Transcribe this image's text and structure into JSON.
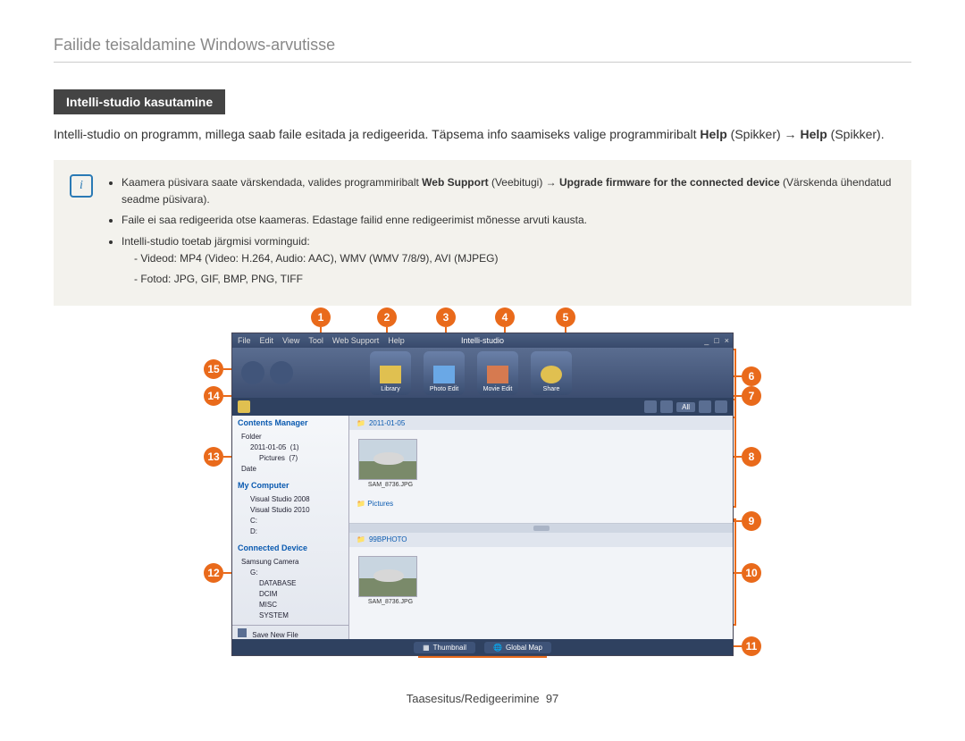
{
  "page": {
    "header": "Failide teisaldamine Windows-arvutisse",
    "section_label": "Intelli-studio kasutamine",
    "intro_html": "Intelli-studio on programm, millega saab faile esitada ja redigeerida. Täpsema info saamiseks valige programmiribalt <b class='kw'>Help</b> (Spikker) → <b class='kw'>Help</b> (Spikker).",
    "footer_section": "Taasesitus/Redigeerimine",
    "footer_page": "97"
  },
  "note": {
    "bullets": [
      "Kaamera püsivara saate värskendada, valides programmiribalt <b class='kw'>Web Support</b> (Veebitugi) → <b class='kw'>Upgrade firmware for the connected device</b> (Värskenda ühendatud seadme püsivara).",
      "Faile ei saa redigeerida otse kaameras. Edastage failid enne redigeerimist mõnesse arvuti kausta.",
      "Intelli-studio toetab järgmisi vorminguid:"
    ],
    "sub_bullets": [
      "Videod: MP4 (Video: H.264, Audio: AAC), WMV (WMV 7/8/9), AVI (MJPEG)",
      "Fotod: JPG, GIF, BMP, PNG, TIFF"
    ]
  },
  "app": {
    "brand": "Intelli-studio",
    "menu": [
      "File",
      "Edit",
      "View",
      "Tool",
      "Web Support",
      "Help"
    ],
    "winctrl": [
      "_",
      "□",
      "×"
    ],
    "tools": [
      {
        "label": "Library"
      },
      {
        "label": "Photo Edit"
      },
      {
        "label": "Movie Edit"
      },
      {
        "label": "Share"
      }
    ],
    "filter": {
      "all": "All"
    },
    "sidebar": {
      "contents_head": "Contents Manager",
      "folder": "Folder",
      "date_folder": "2011-01-05",
      "date_count": "(1)",
      "pictures": "Pictures",
      "pictures_count": "(7)",
      "date_head": "Date",
      "mycomputer_head": "My Computer",
      "vs2008": "Visual Studio 2008",
      "vs2010": "Visual Studio 2010",
      "c": "C:",
      "d": "D:",
      "connected_head": "Connected Device",
      "camera": "Samsung Camera",
      "drive": "G:",
      "d1": "DATABASE",
      "d2": "DCIM",
      "d3": "MISC",
      "d4": "SYSTEM",
      "save": "Save New File"
    },
    "pane1": {
      "crumb": "2011-01-05",
      "thumb": "SAM_8736.JPG",
      "sub": "Pictures"
    },
    "pane2": {
      "crumb": "99BPHOTO",
      "thumb": "SAM_8736.JPG"
    },
    "status": {
      "thumb": "Thumbnail",
      "map": "Global Map"
    }
  },
  "callouts": {
    "1": "1",
    "2": "2",
    "3": "3",
    "4": "4",
    "5": "5",
    "6": "6",
    "7": "7",
    "8": "8",
    "9": "9",
    "10": "10",
    "11": "11",
    "12": "12",
    "13": "13",
    "14": "14",
    "15": "15"
  }
}
